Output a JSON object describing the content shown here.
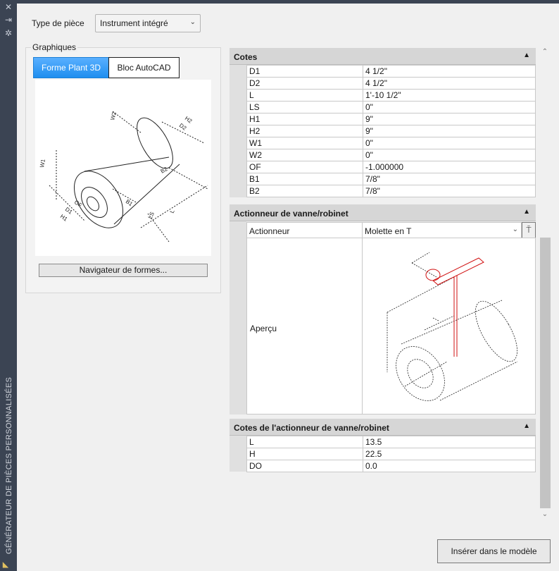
{
  "palette": {
    "close_icon": "×",
    "title": "GÉNÉRATEUR DE PIÈCES PERSONNALISÉES"
  },
  "part_type": {
    "label": "Type de pièce",
    "value": "Instrument intégré"
  },
  "graphics": {
    "title": "Graphiques",
    "tabs": [
      {
        "label": "Forme Plant 3D",
        "active": true
      },
      {
        "label": "Bloc AutoCAD",
        "active": false
      }
    ],
    "navigator_label": "Navigateur de formes..."
  },
  "cotes": {
    "title": "Cotes",
    "rows": [
      {
        "name": "D1",
        "value": "4 1/2\""
      },
      {
        "name": "D2",
        "value": "4 1/2\""
      },
      {
        "name": "L",
        "value": "1'-10 1/2\""
      },
      {
        "name": "LS",
        "value": "0\""
      },
      {
        "name": "H1",
        "value": "9\""
      },
      {
        "name": "H2",
        "value": "9\""
      },
      {
        "name": "W1",
        "value": "0\""
      },
      {
        "name": "W2",
        "value": "0\""
      },
      {
        "name": "OF",
        "value": "-1.000000"
      },
      {
        "name": "B1",
        "value": "7/8\""
      },
      {
        "name": "B2",
        "value": "7/8\""
      }
    ]
  },
  "actuator": {
    "title": "Actionneur de vanne/robinet",
    "actuator_label": "Actionneur",
    "actuator_value": "Molette en T",
    "preview_label": "Aperçu"
  },
  "actuator_dims": {
    "title": "Cotes de l'actionneur de vanne/robinet",
    "rows": [
      {
        "name": "L",
        "value": "13.5"
      },
      {
        "name": "H",
        "value": "22.5"
      },
      {
        "name": "DO",
        "value": "0.0"
      }
    ]
  },
  "insert_button": "Insérer dans le modèle",
  "colors": {
    "strip": "#3b4453",
    "accent": "#1e8eef",
    "section_header": "#d6d6d6",
    "actuator_red": "#d01010"
  }
}
